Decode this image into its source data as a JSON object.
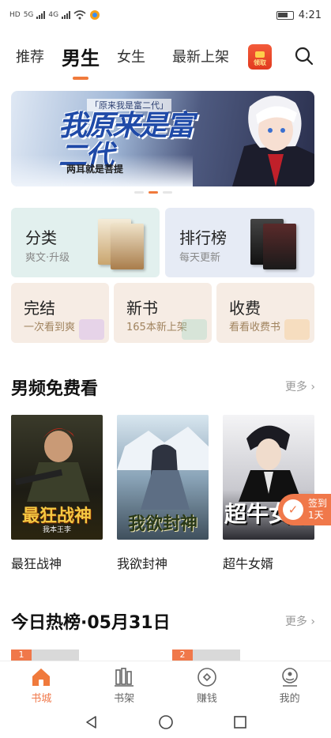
{
  "status_bar": {
    "time": "4:21",
    "net_labels": [
      "HD",
      "5G",
      "4G"
    ]
  },
  "top_nav": {
    "tabs": [
      "推荐",
      "男生",
      "女生",
      "最新上架"
    ],
    "active_tab": "男生",
    "gift_label": "领取"
  },
  "banner": {
    "subtitle": "「原来我是富二代」",
    "title": "我原来是富二代",
    "author": "两耳就是菩提"
  },
  "categories": [
    {
      "title": "分类",
      "subtitle": "爽文·升级"
    },
    {
      "title": "排行榜",
      "subtitle": "每天更新"
    },
    {
      "title": "完结",
      "subtitle": "一次看到爽"
    },
    {
      "title": "新书",
      "subtitle": "165本新上架"
    },
    {
      "title": "收费",
      "subtitle": "看看收费书"
    }
  ],
  "free_section": {
    "title": "男频免费看",
    "more": "更多 ›",
    "books": [
      {
        "name": "最狂战神",
        "cover_text": "最狂战神",
        "cover_author": "我本王李"
      },
      {
        "name": "我欲封神",
        "cover_text": "我欲封神",
        "cover_author": ""
      },
      {
        "name": "超牛女婿",
        "cover_text": "超牛女婿",
        "cover_author": ""
      }
    ]
  },
  "signin": {
    "line1": "签到",
    "line2": "1天"
  },
  "hot_section": {
    "title": "今日热榜·05月31日",
    "more": "更多 ›",
    "ranks": [
      "1",
      "2"
    ]
  },
  "bottom_nav": {
    "items": [
      "书城",
      "书架",
      "赚钱",
      "我的"
    ],
    "active": "书城"
  },
  "colors": {
    "accent": "#f07a3c",
    "active_text": "#111111"
  }
}
